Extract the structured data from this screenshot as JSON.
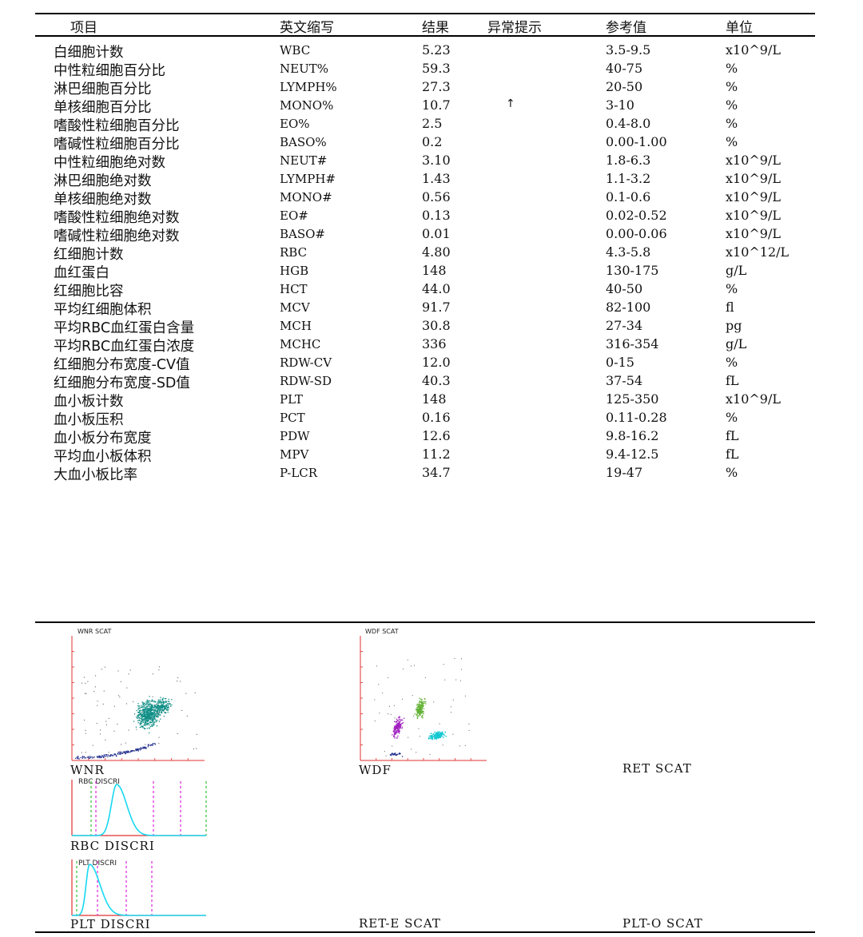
{
  "headers": {
    "item": "项目",
    "abbr": "英文缩写",
    "result": "结果",
    "flag": "异常提示",
    "ref": "参考值",
    "unit": "单位"
  },
  "rows": [
    {
      "name": "白细胞计数",
      "abbr": "WBC",
      "result": "5.23",
      "flag": "",
      "ref": "3.5-9.5",
      "unit": "x10^9/L"
    },
    {
      "name": "中性粒细胞百分比",
      "abbr": "NEUT%",
      "result": "59.3",
      "flag": "",
      "ref": "40-75",
      "unit": "%"
    },
    {
      "name": "淋巴细胞百分比",
      "abbr": "LYMPH%",
      "result": "27.3",
      "flag": "",
      "ref": "20-50",
      "unit": "%"
    },
    {
      "name": "单核细胞百分比",
      "abbr": "MONO%",
      "result": "10.7",
      "flag": "↑",
      "ref": "3-10",
      "unit": "%"
    },
    {
      "name": "嗜酸性粒细胞百分比",
      "abbr": "EO%",
      "result": "2.5",
      "flag": "",
      "ref": "0.4-8.0",
      "unit": "%"
    },
    {
      "name": "嗜碱性粒细胞百分比",
      "abbr": "BASO%",
      "result": "0.2",
      "flag": "",
      "ref": "0.00-1.00",
      "unit": "%"
    },
    {
      "name": "中性粒细胞绝对数",
      "abbr": "NEUT#",
      "result": "3.10",
      "flag": "",
      "ref": "1.8-6.3",
      "unit": "x10^9/L"
    },
    {
      "name": "淋巴细胞绝对数",
      "abbr": "LYMPH#",
      "result": "1.43",
      "flag": "",
      "ref": "1.1-3.2",
      "unit": "x10^9/L"
    },
    {
      "name": "单核细胞绝对数",
      "abbr": "MONO#",
      "result": "0.56",
      "flag": "",
      "ref": "0.1-0.6",
      "unit": "x10^9/L"
    },
    {
      "name": "嗜酸性粒细胞绝对数",
      "abbr": "EO#",
      "result": "0.13",
      "flag": "",
      "ref": "0.02-0.52",
      "unit": "x10^9/L"
    },
    {
      "name": "嗜碱性粒细胞绝对数",
      "abbr": "BASO#",
      "result": "0.01",
      "flag": "",
      "ref": "0.00-0.06",
      "unit": "x10^9/L"
    },
    {
      "name": "红细胞计数",
      "abbr": "RBC",
      "result": "4.80",
      "flag": "",
      "ref": "4.3-5.8",
      "unit": "x10^12/L"
    },
    {
      "name": "血红蛋白",
      "abbr": "HGB",
      "result": "148",
      "flag": "",
      "ref": "130-175",
      "unit": "g/L"
    },
    {
      "name": "红细胞比容",
      "abbr": "HCT",
      "result": "44.0",
      "flag": "",
      "ref": "40-50",
      "unit": "%"
    },
    {
      "name": "平均红细胞体积",
      "abbr": "MCV",
      "result": "91.7",
      "flag": "",
      "ref": "82-100",
      "unit": "fl"
    },
    {
      "name": "平均RBC血红蛋白含量",
      "abbr": "MCH",
      "result": "30.8",
      "flag": "",
      "ref": "27-34",
      "unit": "pg"
    },
    {
      "name": "平均RBC血红蛋白浓度",
      "abbr": "MCHC",
      "result": "336",
      "flag": "",
      "ref": "316-354",
      "unit": "g/L"
    },
    {
      "name": "红细胞分布宽度-CV值",
      "abbr": "RDW-CV",
      "result": "12.0",
      "flag": "",
      "ref": "0-15",
      "unit": "%"
    },
    {
      "name": "红细胞分布宽度-SD值",
      "abbr": "RDW-SD",
      "result": "40.3",
      "flag": "",
      "ref": "37-54",
      "unit": "fL"
    },
    {
      "name": "血小板计数",
      "abbr": "PLT",
      "result": "148",
      "flag": "",
      "ref": "125-350",
      "unit": "x10^9/L"
    },
    {
      "name": "血小板压积",
      "abbr": "PCT",
      "result": "0.16",
      "flag": "",
      "ref": "0.11-0.28",
      "unit": "%"
    },
    {
      "name": "血小板分布宽度",
      "abbr": "PDW",
      "result": "12.6",
      "flag": "",
      "ref": "9.8-16.2",
      "unit": "fL"
    },
    {
      "name": "平均血小板体积",
      "abbr": "MPV",
      "result": "11.2",
      "flag": "",
      "ref": "9.4-12.5",
      "unit": "fL"
    },
    {
      "name": "大血小板比率",
      "abbr": "P-LCR",
      "result": "34.7",
      "flag": "",
      "ref": "19-47",
      "unit": "%"
    }
  ],
  "plots": {
    "wnr_title": "WNR SCAT",
    "wnr_label": "WNR",
    "wdf_title": "WDF SCAT",
    "wdf_label": "WDF",
    "ret_label": "RET SCAT",
    "rbc_title": "RBC DISCRI",
    "rbc_label": "RBC DISCRI",
    "plt_title": "PLT DISCRI",
    "plt_label": "PLT DISCRI",
    "rete_label": "RET-E SCAT",
    "plto_label": "PLT-O SCAT"
  },
  "colors": {
    "axis": "#e03030",
    "wnr_cluster": "#0f8f86",
    "lymph": "#1e2a8c",
    "purple": "#a020c0",
    "green": "#5fb030",
    "cyan": "#12c8d2",
    "curve": "#18d8f0",
    "marker_green": "#30c030",
    "marker_magenta": "#e020e0"
  }
}
